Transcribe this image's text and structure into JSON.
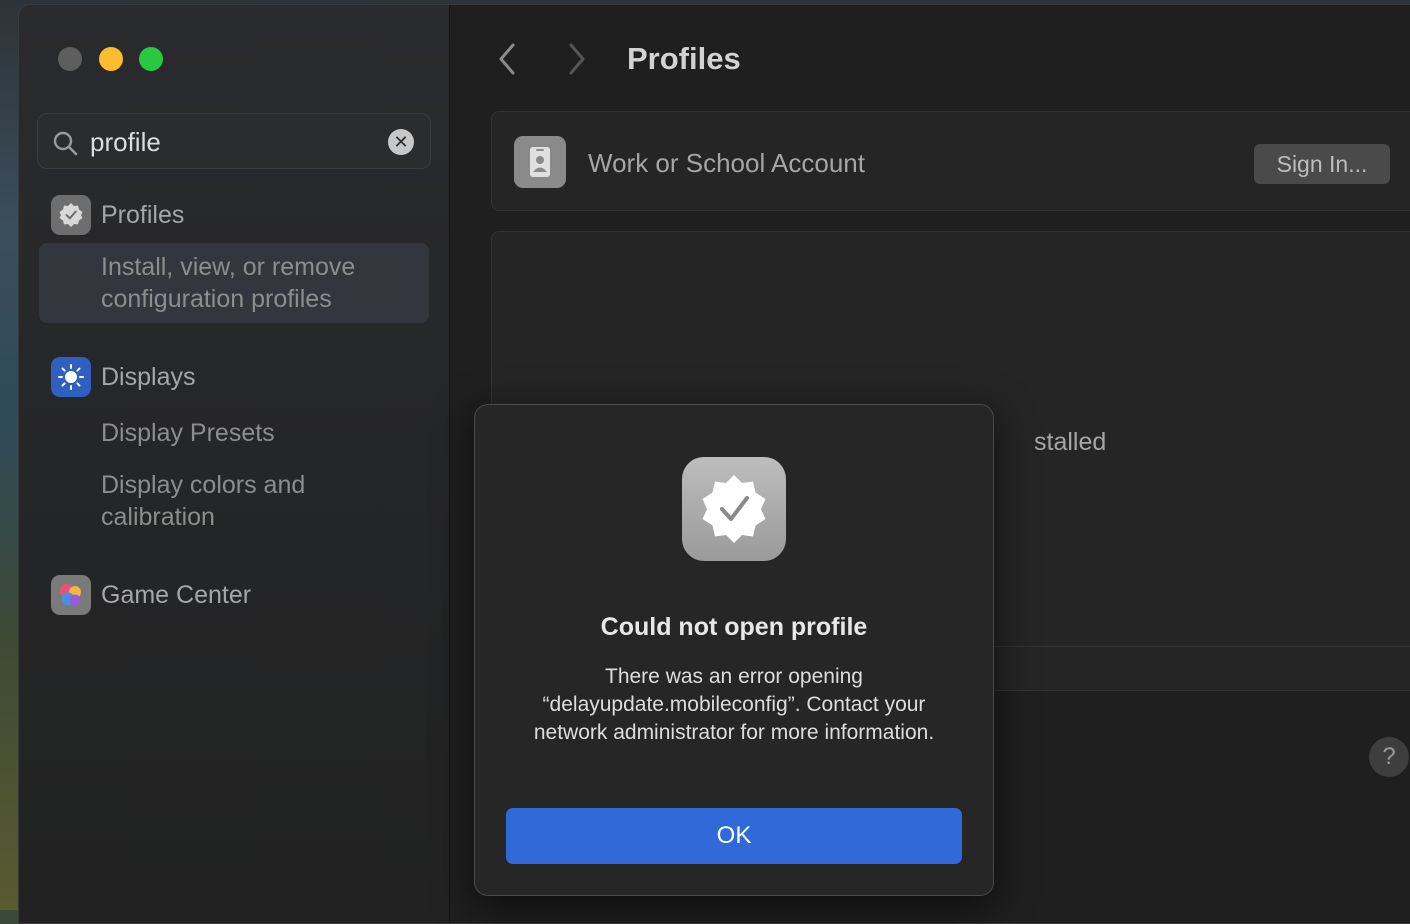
{
  "window": {
    "title": "Profiles"
  },
  "sidebar": {
    "search": {
      "value": "profile",
      "placeholder": "Search"
    },
    "results": [
      {
        "label": "Profiles",
        "icon": "profiles-badge-icon",
        "subitems": [
          "Install, view, or remove configuration profiles"
        ]
      },
      {
        "label": "Displays",
        "icon": "sun-icon",
        "subitems": [
          "Display Presets",
          "Display colors and calibration"
        ]
      },
      {
        "label": "Game Center",
        "icon": "game-center-icon",
        "subitems": []
      }
    ],
    "sub_profiles_line1": "Install, view, or remove",
    "sub_profiles_line2": "configuration profiles",
    "sub_displays_1": "Display Presets",
    "sub_displays_2_line1": "Display colors and",
    "sub_displays_2_line2": "calibration"
  },
  "main": {
    "title": "Profiles",
    "account": {
      "label": "Work or School Account",
      "button": "Sign In..."
    },
    "empty_state_partial": "stalled",
    "help": "?"
  },
  "dialog": {
    "title": "Could not open profile",
    "message": "There was an error opening “delayupdate.mobileconfig”. Contact your network administrator for more information.",
    "ok_label": "OK"
  },
  "colors": {
    "accent": "#2f6ad8",
    "close": "#5e5e5e",
    "minimize": "#fbbd2e",
    "maximize": "#29c841"
  }
}
